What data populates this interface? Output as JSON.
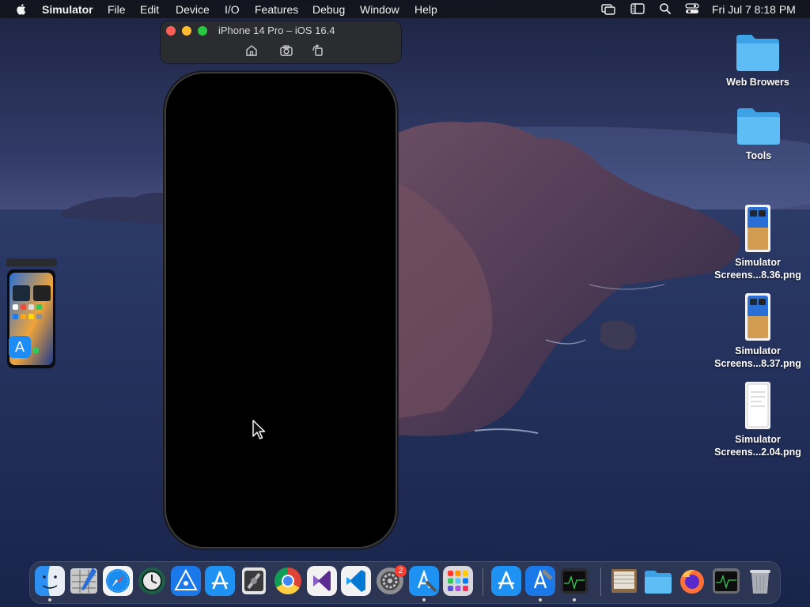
{
  "menubar": {
    "app_name": "Simulator",
    "items": [
      "File",
      "Edit",
      "Device",
      "I/O",
      "Features",
      "Debug",
      "Window",
      "Help"
    ],
    "clock": "Fri Jul 7  8:18 PM"
  },
  "simulator": {
    "title": "iPhone 14 Pro – iOS 16.4",
    "toolbar_icons": [
      "home-icon",
      "screenshot-icon",
      "rotate-icon"
    ]
  },
  "desktop_icons": [
    {
      "label_lines": [
        "Web Browers"
      ],
      "kind": "folder"
    },
    {
      "label_lines": [
        "Tools"
      ],
      "kind": "folder"
    },
    {
      "label_lines": [
        "Simulator",
        "Screens...8.36.png"
      ],
      "kind": "screenshot"
    },
    {
      "label_lines": [
        "Simulator",
        "Screens...8.37.png"
      ],
      "kind": "screenshot"
    },
    {
      "label_lines": [
        "Simulator",
        "Screens...2.04.png"
      ],
      "kind": "document"
    }
  ],
  "dock": {
    "apps": [
      "Finder",
      "Script Editor",
      "Safari",
      "Time Machine",
      "Xcode Instruments",
      "App Store",
      "Simulator",
      "Google Chrome",
      "Visual Studio",
      "Visual Studio Code",
      "System Settings",
      "Simulator Instruments",
      "Launchpad",
      "App Store",
      "Xcode",
      "Console",
      "Archive Utility",
      "Downloads",
      "Firefox",
      "Activity Monitor",
      "Trash"
    ],
    "settings_badge": "2"
  },
  "colors": {
    "traffic_close": "#ff5f57",
    "traffic_min": "#febc2e",
    "traffic_max": "#28c840",
    "badge": "#ff3b30"
  }
}
